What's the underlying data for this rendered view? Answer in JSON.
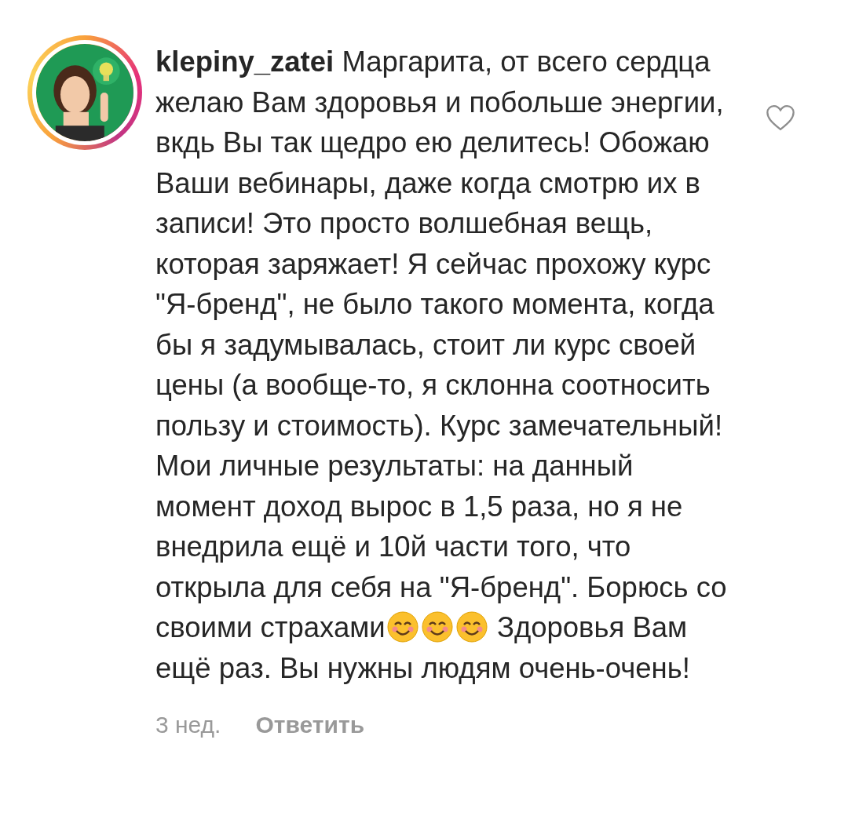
{
  "comment": {
    "username": "klepiny_zatei",
    "segments": [
      {
        "kind": "text",
        "text": "Маргарита, от всего сердца желаю Вам здоровья и побольше энергии, вкдь Вы так щедро ею делитесь! Обожаю Ваши вебинары, даже когда смотрю их в записи! Это просто волшебная вещь, которая заряжает! Я сейчас прохожу курс \"Я-бренд\", не было такого момента, когда бы я задумывалась, стоит ли курс своей цены (а вообще-то, я склонна соотносить пользу и стоимость). Курс замечательный! Мои личные результаты: на данный момент доход вырос в 1,5 раза, но я не внедрила ещё и 10й части того, что открыла для себя на \"Я-бренд\". Борюсь со своими страхами"
      },
      {
        "kind": "emoji"
      },
      {
        "kind": "emoji"
      },
      {
        "kind": "emoji"
      },
      {
        "kind": "text",
        "text": " Здоровья Вам ещё раз. Вы нужны людям очень-очень!"
      }
    ],
    "liked": false,
    "time": "3 нед.",
    "reply_label": "Ответить"
  }
}
